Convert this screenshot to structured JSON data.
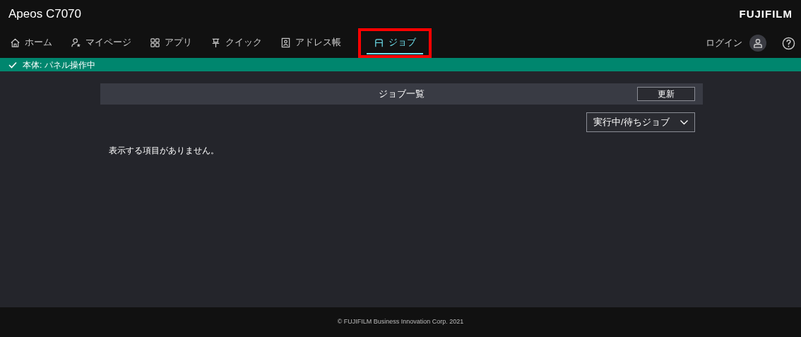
{
  "header": {
    "title": "Apeos C7070",
    "logo": "FUJIFILM"
  },
  "nav": {
    "tabs": [
      {
        "label": "ホーム",
        "kind": "home",
        "selected": false,
        "highlighted": false
      },
      {
        "label": "マイページ",
        "kind": "mypage",
        "selected": false,
        "highlighted": false
      },
      {
        "label": "アプリ",
        "kind": "apps",
        "selected": false,
        "highlighted": false
      },
      {
        "label": "クイック",
        "kind": "quick",
        "selected": false,
        "highlighted": false
      },
      {
        "label": "アドレス帳",
        "kind": "address",
        "selected": false,
        "highlighted": false
      },
      {
        "label": "ジョブ",
        "kind": "job",
        "selected": true,
        "highlighted": true
      }
    ],
    "login": "ログイン"
  },
  "status_bar": {
    "text": "本体: パネル操作中"
  },
  "jobs": {
    "title": "ジョブ一覧",
    "refresh": "更新",
    "filter": "実行中/待ちジョブ",
    "empty_message": "表示する項目がありません。"
  },
  "footer": "© FUJIFILM Business Innovation Corp. 2021"
}
